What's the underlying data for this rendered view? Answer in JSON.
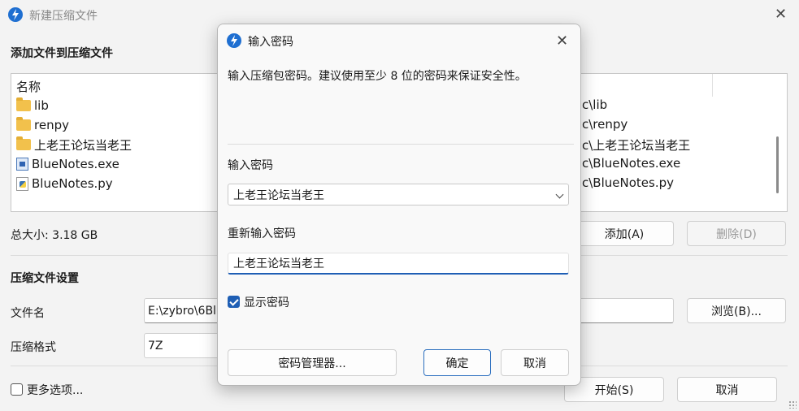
{
  "main": {
    "title": "新建压缩文件",
    "add_section_title": "添加文件到压缩文件",
    "list_header": "名称",
    "files": [
      {
        "name": "lib",
        "type": "folder",
        "path": "c\\lib"
      },
      {
        "name": "renpy",
        "type": "folder",
        "path": "c\\renpy"
      },
      {
        "name": "上老王论坛当老王",
        "type": "folder",
        "path": "c\\上老王论坛当老王"
      },
      {
        "name": "BlueNotes.exe",
        "type": "exe",
        "path": "c\\BlueNotes.exe"
      },
      {
        "name": "BlueNotes.py",
        "type": "py",
        "path": "c\\BlueNotes.py"
      }
    ],
    "total_size": "总大小: 3.18 GB",
    "add_button": "添加(A)",
    "delete_button": "删除(D)",
    "settings_title": "压缩文件设置",
    "filename_label": "文件名",
    "filename_value": "E:\\zybro\\6Bl",
    "browse_button": "浏览(B)...",
    "format_label": "压缩格式",
    "format_value": "7Z",
    "more_options": "更多选项...",
    "start_button": "开始(S)",
    "cancel_button": "取消"
  },
  "dialog": {
    "title": "输入密码",
    "description": "输入压缩包密码。建议使用至少 8 位的密码来保证安全性。",
    "password_label": "输入密码",
    "password_value": "上老王论坛当老王",
    "repeat_label": "重新输入密码",
    "repeat_value": "上老王论坛当老王",
    "show_password_label": "显示密码",
    "show_password_checked": true,
    "manager_button": "密码管理器...",
    "ok_button": "确定",
    "cancel_button": "取消"
  },
  "colors": {
    "accent": "#1f5fb5",
    "folder": "#f2c14c"
  }
}
